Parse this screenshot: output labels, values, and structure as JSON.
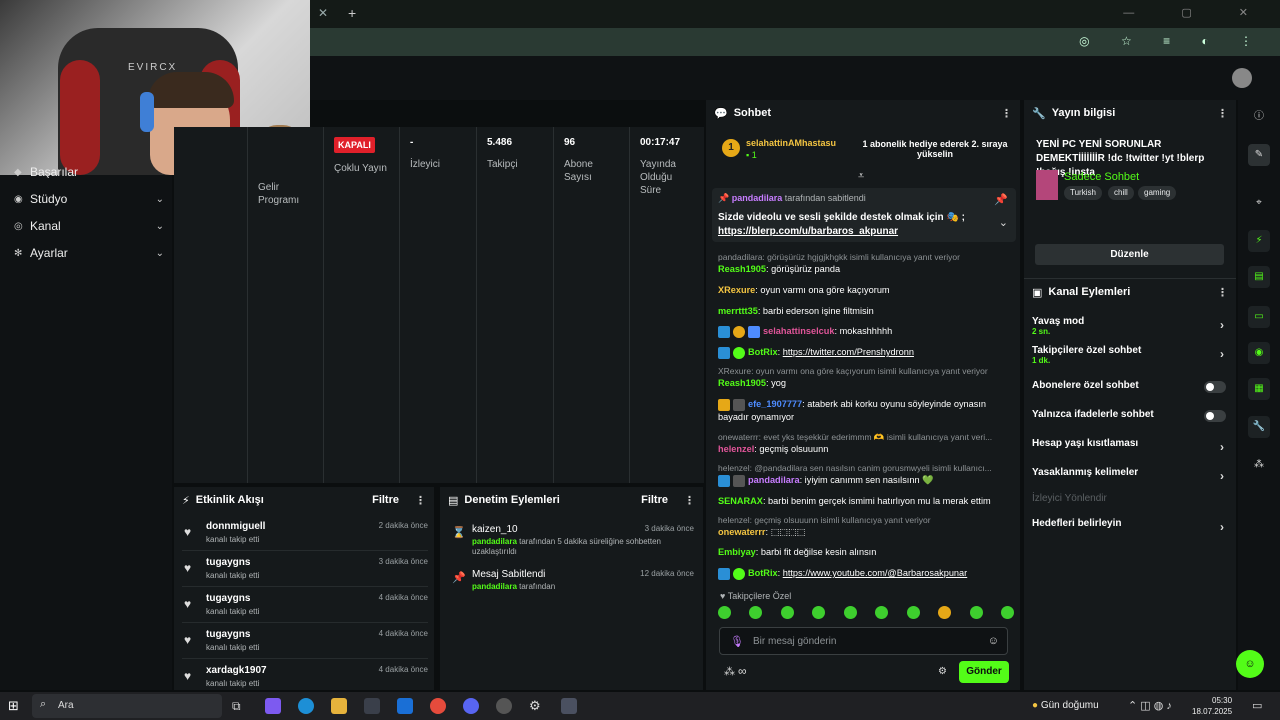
{
  "browser": {
    "close_glyph": "✕",
    "plus_glyph": "+",
    "win_controls": "— ▢ ✕",
    "addr_icons": "◎ ☆ ≡ ◐ ⋮"
  },
  "webcam": {
    "brand": "EVIRCX"
  },
  "sidebar": {
    "items": [
      {
        "label": "Başarılar",
        "icon": "trophy-icon"
      },
      {
        "label": "Stüdyo",
        "icon": "studio-icon"
      },
      {
        "label": "Kanal",
        "icon": "channel-icon"
      },
      {
        "label": "Ayarlar",
        "icon": "gear-icon"
      }
    ]
  },
  "stats": {
    "live_badge": "KAPALI",
    "columns": [
      {
        "value": "",
        "label": "Gelir Programı"
      },
      {
        "value": "",
        "label": "Çoklu Yayın"
      },
      {
        "value": "-",
        "label": "İzleyici"
      },
      {
        "value": "5.486",
        "label": "Takipçi"
      },
      {
        "value": "96",
        "label": "Abone Sayısı"
      },
      {
        "value": "00:17:47",
        "label": "Yayında Olduğu Süre"
      }
    ]
  },
  "activity": {
    "title": "Etkinlik Akışı",
    "filter": "Filtre",
    "rows": [
      {
        "name": "donnmiguell",
        "sub": "kanalı takip etti",
        "time": "2 dakika önce"
      },
      {
        "name": "tugaygns",
        "sub": "kanalı takip etti",
        "time": "3 dakika önce"
      },
      {
        "name": "tugaygns",
        "sub": "kanalı takip etti",
        "time": "4 dakika önce"
      },
      {
        "name": "tugaygns",
        "sub": "kanalı takip etti",
        "time": "4 dakika önce"
      },
      {
        "name": "xardagk1907",
        "sub": "kanalı takip etti",
        "time": "4 dakika önce"
      }
    ]
  },
  "moderation": {
    "title": "Denetim Eylemleri",
    "filter": "Filtre",
    "rows": [
      {
        "name": "kaizen_10",
        "user": "pandadilara",
        "sub": " tarafından 5 dakika süreliğine sohbetten uzaklaştırıldı",
        "time": "3 dakika önce"
      },
      {
        "name": "Mesaj Sabitlendi",
        "user": "pandadilara",
        "sub": " tarafından",
        "time": "12 dakika önce"
      }
    ]
  },
  "chat": {
    "title": "Sohbet",
    "gift": {
      "user": "selahattinAMhastasu",
      "count": "1",
      "message": "1 abonelik hediye ederek 2. sıraya yükselin",
      "coin": "1"
    },
    "pinned": {
      "by": "pandadilara",
      "by_suffix": " tarafından sabitlendi",
      "text": "Sizde videolu ve sesli şekilde destek olmak için 🎭 ;",
      "link": "https://blerp.com/u/barbaros_akpunar"
    },
    "messages": [
      {
        "reply": "pandadilara: görüşürüz hgjgjkhgkk isimli kullanıcıya yanıt veriyor"
      },
      {
        "user": "Reash1905",
        "color": "#53fc18",
        "text": ": görüşürüz panda"
      },
      {
        "user": "XRexure",
        "color": "#f4c542",
        "text": ": oyun varmı ona göre kaçıyorum"
      },
      {
        "user": "merrttt35",
        "color": "#53fc18",
        "text": ": barbi ederson işine filtmisin"
      },
      {
        "user": "selahattinselcuk",
        "color": "#e05599",
        "text": ": mokashhhhh"
      },
      {
        "user": "BotRix",
        "color": "#53fc18",
        "text": ": ",
        "link": "https://twitter.com/Prenshydronn"
      },
      {
        "reply": "XRexure: oyun varmı ona göre kaçıyorum isimli kullanıcıya yanıt veriyor"
      },
      {
        "user": "Reash1905",
        "color": "#53fc18",
        "text": ": yog"
      },
      {
        "user": "efe_1907777",
        "color": "#4e8cff",
        "text": ": ataberk abi korku oyunu söyleyinde oynasın bayadır oynamıyor"
      },
      {
        "reply": "onewaterrr: evet yks teşekkür ederimmm 🫶 isimli kullanıcıya yanıt veri..."
      },
      {
        "user": "helenzel",
        "color": "#e05599",
        "text": ": geçmiş olsuuunn"
      },
      {
        "reply": "helenzel: @pandadilara sen nasılsın canim gorusmwyeli isimli kullanıcı..."
      },
      {
        "user": "pandadilara",
        "color": "#c77dff",
        "text": ": iyiyim canımm sen nasılsınn 💚"
      },
      {
        "user": "SENARAX",
        "color": "#53fc18",
        "text": ": barbi benim gerçek ismimi hatırlıyon mu la merak ettim"
      },
      {
        "reply": "helenzel: geçmiş olsuuunn isimli kullanıcıya yanıt veriyor"
      },
      {
        "user": "onewaterrr",
        "color": "#f4c542",
        "text": ": ⬚⬚⬚⬚"
      },
      {
        "user": "Embiyay",
        "color": "#53fc18",
        "text": ": barbi fit değilse kesin alınsın"
      },
      {
        "user": "BotRix",
        "color": "#53fc18",
        "text": ": ",
        "link": "https://www.youtube.com/@Barbarosakpunar"
      }
    ],
    "followers_only": "Takipçilere Özel",
    "input_placeholder": "Bir mesaj gönderin",
    "send": "Gönder",
    "infinity": "∞"
  },
  "info": {
    "title": "Yayın bilgisi",
    "stream_title": "YENİ PC YENİ SORUNLAR DEMEKTİİİİİİİR !dc !twitter !yt !blerp !bağış !insta",
    "category": "Sadece Sohbet",
    "tags": [
      "Turkish",
      "chill",
      "gaming"
    ],
    "edit": "Düzenle",
    "actions_title": "Kanal Eylemleri",
    "actions": [
      {
        "label": "Yavaş mod",
        "sub": "2 sn.",
        "kind": "chev"
      },
      {
        "label": "Takipçilere özel sohbet",
        "sub": "1 dk.",
        "kind": "chev"
      },
      {
        "label": "Abonelere özel sohbet",
        "sub": "",
        "kind": "toggle"
      },
      {
        "label": "Yalnızca ifadelerle sohbet",
        "sub": "",
        "kind": "toggle"
      },
      {
        "label": "Hesap yaşı kısıtlaması",
        "sub": "",
        "kind": "chev"
      },
      {
        "label": "Yasaklanmış kelimeler",
        "sub": "",
        "kind": "chev"
      },
      {
        "label": "İzleyici Yönlendir",
        "sub": "",
        "kind": "disabled"
      },
      {
        "label": "Hedefleri belirleyin",
        "sub": "",
        "kind": "chev"
      }
    ]
  },
  "taskbar": {
    "search": "Ara",
    "weather": "Gün doğumu",
    "time": "05:30",
    "date": "18.07.2025"
  }
}
